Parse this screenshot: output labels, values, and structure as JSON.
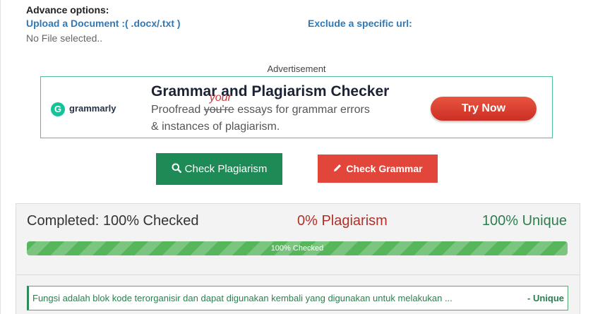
{
  "advance_options": {
    "title": "Advance options:",
    "upload_label": "Upload a Document :( .docx/.txt )",
    "exclude_label": "Exclude a specific url:",
    "file_status": "No File selected.."
  },
  "ad": {
    "label": "Advertisement",
    "brand": "grammarly",
    "brand_icon": "G",
    "headline": "Grammar and Plagiarism Checker",
    "line1_prefix": "Proofread ",
    "struck_word": "you're",
    "correction_word": "your",
    "line1_suffix": " essays for grammar errors",
    "line2": "& instances of plagiarism.",
    "cta": "Try Now"
  },
  "actions": {
    "check_plagiarism": "Check Plagiarism",
    "check_grammar": "Check Grammar"
  },
  "results": {
    "completed": "Completed: 100% Checked",
    "plagiarism": "0% Plagiarism",
    "unique": "100% Unique",
    "progress_percent": 100,
    "progress_label": "100% Checked",
    "rows": [
      {
        "text": "Fungsi adalah blok kode terorganisir dan dapat digunakan kembali yang digunakan untuk melakukan ...",
        "status": "- Unique"
      }
    ]
  },
  "colors": {
    "link": "#2f79b8",
    "plagiarism_button": "#1e8a55",
    "grammar_button": "#e2463a",
    "plagiarism_text": "#b0302a",
    "unique_text": "#2e7d4f",
    "progress": "#57b55c"
  },
  "icons": {
    "plagiarism_button": "search-icon",
    "grammar_button": "pencil-icon"
  }
}
